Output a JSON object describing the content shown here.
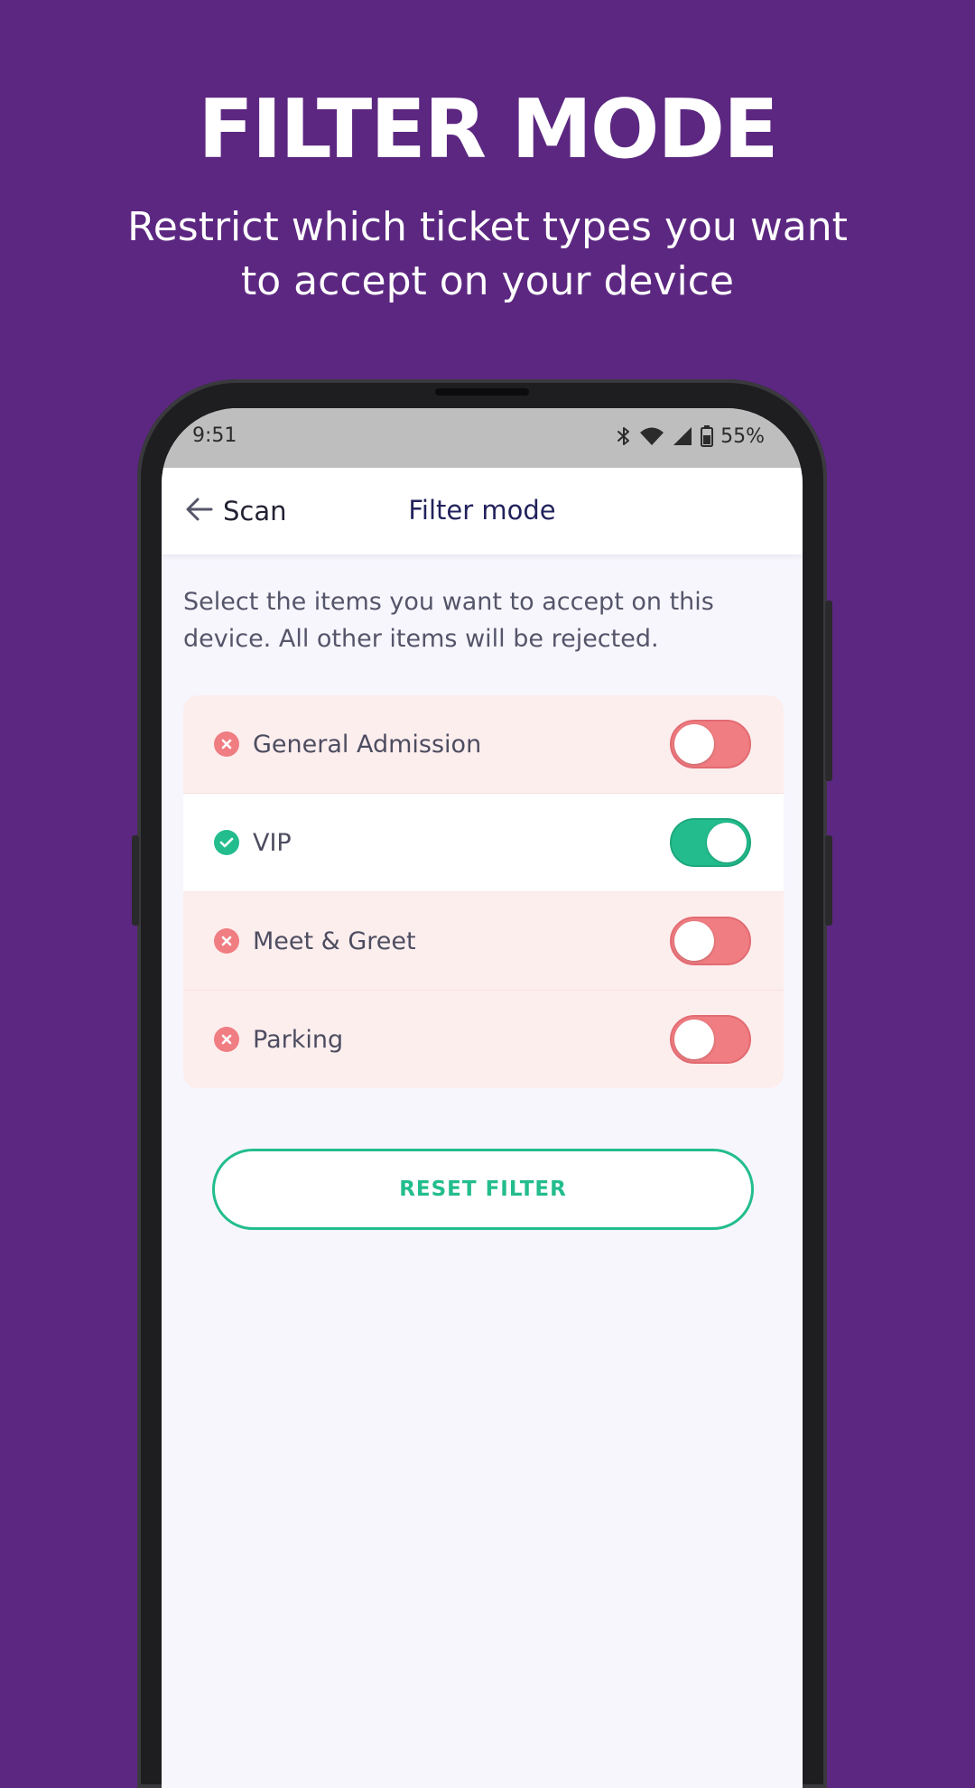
{
  "promo": {
    "title": "FILTER MODE",
    "subtitle": "Restrict which ticket types you want to accept on your device"
  },
  "status_bar": {
    "time": "9:51",
    "battery_percent": "55%",
    "icons": [
      "bluetooth-icon",
      "wifi-icon",
      "signal-icon",
      "battery-icon"
    ]
  },
  "app_bar": {
    "back_label": "Scan",
    "title": "Filter mode"
  },
  "instructions": "Select the items you want to accept on this device. All other items will be rejected.",
  "filter_items": [
    {
      "label": "General Admission",
      "enabled": false
    },
    {
      "label": "VIP",
      "enabled": true
    },
    {
      "label": "Meet & Greet",
      "enabled": false
    },
    {
      "label": "Parking",
      "enabled": false
    }
  ],
  "reset_button": {
    "label": "RESET FILTER"
  },
  "colors": {
    "background": "#5c2781",
    "accent_green": "#23bd8d",
    "reject_red": "#f07d82",
    "title_navy": "#22225c"
  }
}
